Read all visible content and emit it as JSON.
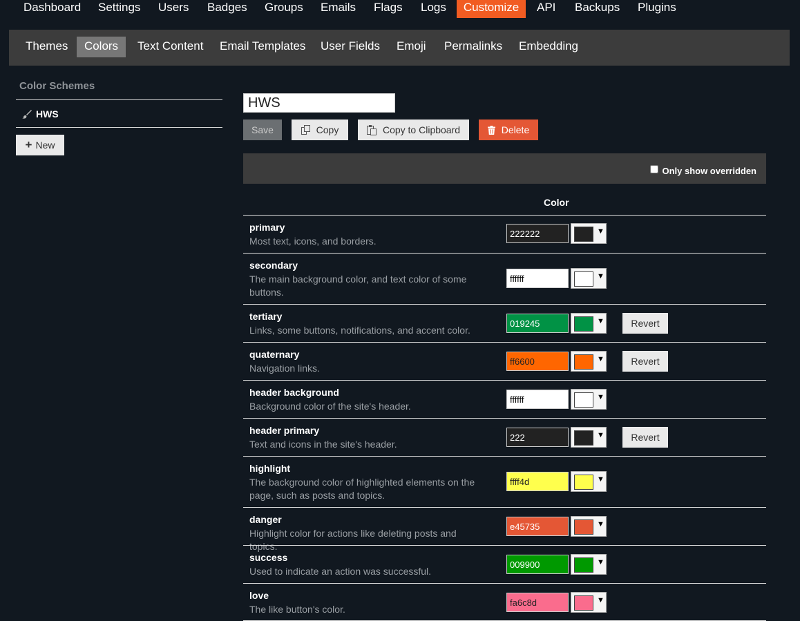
{
  "topnav": [
    "Dashboard",
    "Settings",
    "Users",
    "Badges",
    "Groups",
    "Emails",
    "Flags",
    "Logs",
    "Customize",
    "API",
    "Backups",
    "Plugins"
  ],
  "subnav": [
    "Themes",
    "Colors",
    "Text Content",
    "Email Templates",
    "User Fields",
    "Emoji",
    "Permalinks",
    "Embedding"
  ],
  "sidebar": {
    "title": "Color Schemes",
    "scheme": "HWS",
    "new_label": "New"
  },
  "scheme_name": "HWS",
  "actions": {
    "save": "Save",
    "copy": "Copy",
    "clipboard": "Copy to Clipboard",
    "delete": "Delete"
  },
  "filter": {
    "label": "Only show overridden"
  },
  "table": {
    "column": "Color"
  },
  "revert_label": "Revert",
  "colors": [
    {
      "name": "primary",
      "desc": "Most text, icons, and borders.",
      "hex": "222222",
      "color": "#222222",
      "text": "#ffffff",
      "revert": false
    },
    {
      "name": "secondary",
      "desc": "The main background color, and text color of some buttons.",
      "hex": "ffffff",
      "color": "#ffffff",
      "text": "#000000",
      "revert": false
    },
    {
      "name": "tertiary",
      "desc": "Links, some buttons, notifications, and accent color.",
      "hex": "019245",
      "color": "#019245",
      "text": "#ffffff",
      "revert": true
    },
    {
      "name": "quaternary",
      "desc": "Navigation links.",
      "hex": "ff6600",
      "color": "#ff6600",
      "text": "#222222",
      "revert": true
    },
    {
      "name": "header background",
      "desc": "Background color of the site's header.",
      "hex": "ffffff",
      "color": "#ffffff",
      "text": "#000000",
      "revert": false
    },
    {
      "name": "header primary",
      "desc": "Text and icons in the site's header.",
      "hex": "222",
      "color": "#222222",
      "text": "#ffffff",
      "revert": true
    },
    {
      "name": "highlight",
      "desc": "The background color of highlighted elements on the page, such as posts and topics.",
      "hex": "ffff4d",
      "color": "#ffff4d",
      "text": "#222222",
      "revert": false
    },
    {
      "name": "danger",
      "desc": "Highlight color for actions like deleting posts and topics.",
      "hex": "e45735",
      "color": "#e45735",
      "text": "#ffffff",
      "revert": false
    },
    {
      "name": "success",
      "desc": "Used to indicate an action was successful.",
      "hex": "009900",
      "color": "#009900",
      "text": "#ffffff",
      "revert": false
    },
    {
      "name": "love",
      "desc": "The like button's color.",
      "hex": "fa6c8d",
      "color": "#fa6c8d",
      "text": "#222222",
      "revert": false
    }
  ]
}
